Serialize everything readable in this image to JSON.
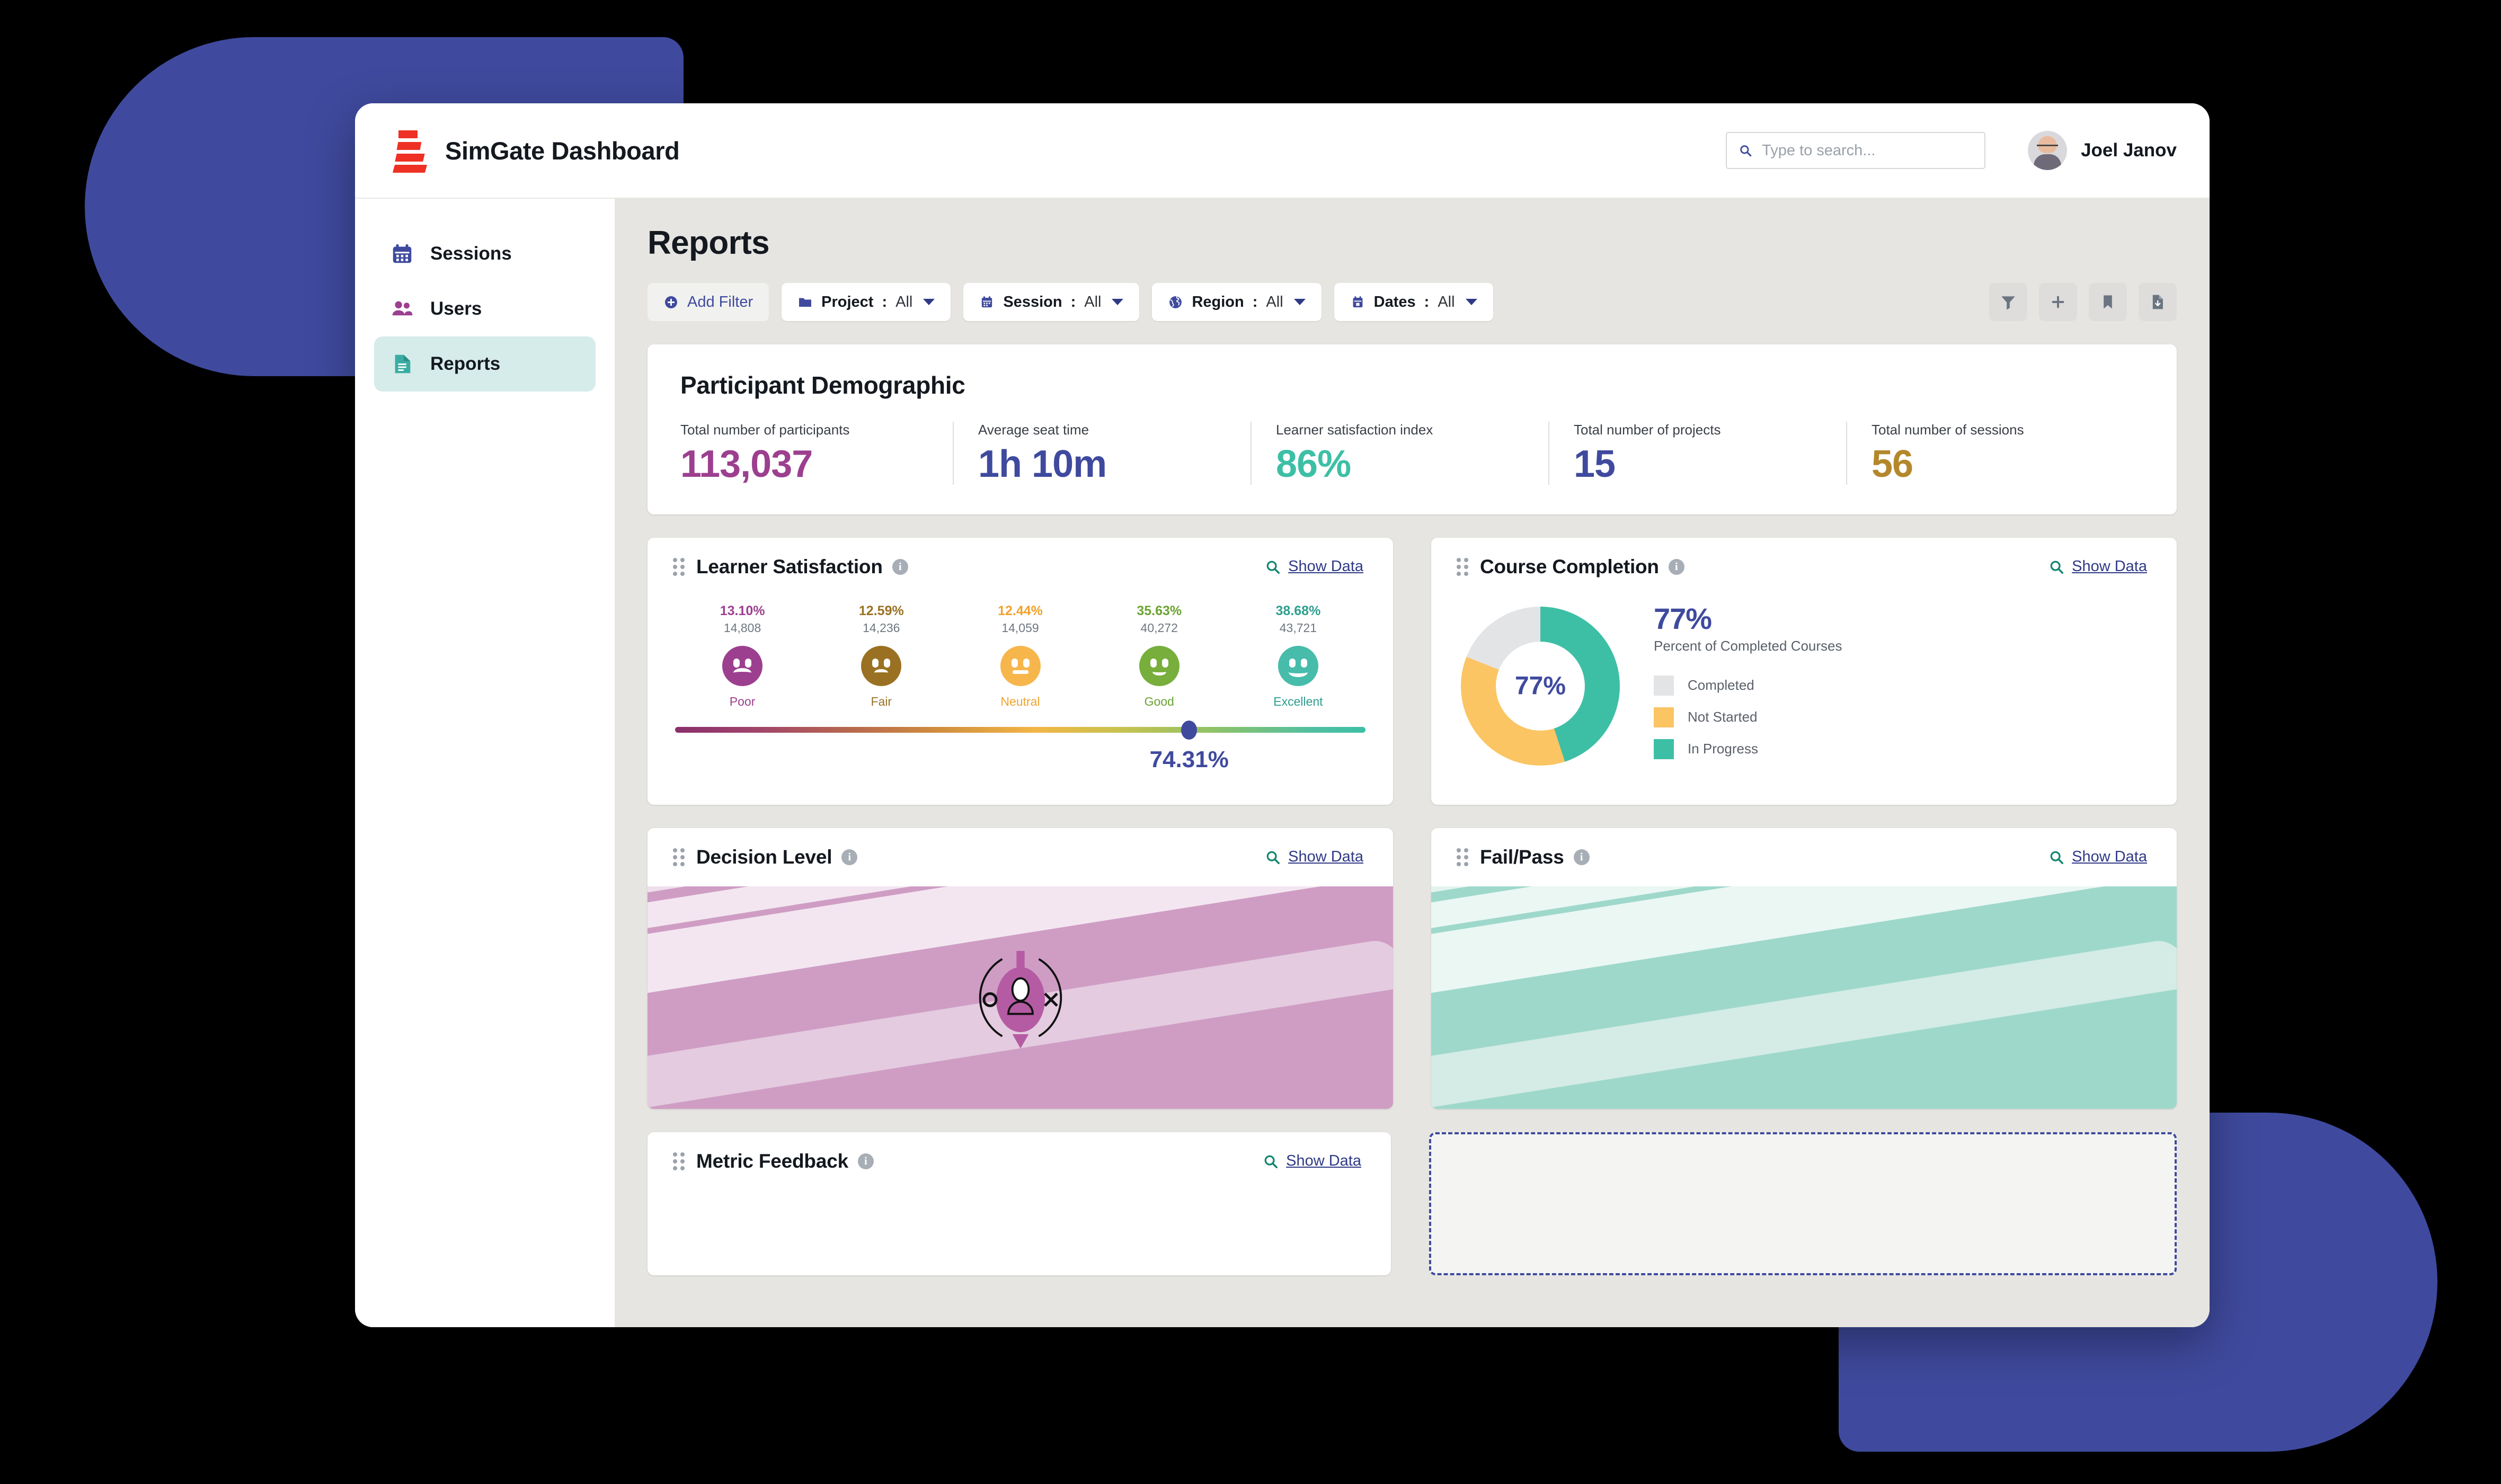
{
  "app": {
    "title": "SimGate Dashboard",
    "logo_icon": "simgate-bars-logo",
    "brand_color": "#ee3124"
  },
  "search": {
    "placeholder": "Type to search...",
    "value": "",
    "icon": "search-icon"
  },
  "user": {
    "name": "Joel Janov",
    "avatar_icon": "user-avatar"
  },
  "sidebar": {
    "items": [
      {
        "label": "Sessions",
        "icon": "calendar-icon",
        "color": "#3f4a9e",
        "active": false
      },
      {
        "label": "Users",
        "icon": "people-icon",
        "color": "#9c3f8f",
        "active": false
      },
      {
        "label": "Reports",
        "icon": "document-icon",
        "color": "#3aada3",
        "active": true
      }
    ]
  },
  "page": {
    "title": "Reports"
  },
  "filters": {
    "add_filter": {
      "label": "Add Filter",
      "icon": "plus-circle-icon"
    },
    "chips": [
      {
        "name": "Project",
        "value": "All",
        "icon": "folder-icon"
      },
      {
        "name": "Session",
        "value": "All",
        "icon": "calendar-icon"
      },
      {
        "name": "Region",
        "value": "All",
        "icon": "globe-icon"
      },
      {
        "name": "Dates",
        "value": "All",
        "icon": "calendar-date-icon"
      }
    ],
    "tools": [
      {
        "icon": "funnel-filter-icon",
        "name": "filter"
      },
      {
        "icon": "plus-icon",
        "name": "add"
      },
      {
        "icon": "bookmark-icon",
        "name": "bookmark"
      },
      {
        "icon": "file-download-icon",
        "name": "export"
      }
    ]
  },
  "demographic": {
    "title": "Participant Demographic",
    "stats": [
      {
        "label": "Total number of participants",
        "value": "113,037",
        "color": "#9c3f8f"
      },
      {
        "label": "Average seat time",
        "value": "1h 10m",
        "color": "#3f4a9e"
      },
      {
        "label": "Learner satisfaction index",
        "value": "86%",
        "color": "#3dbfa5"
      },
      {
        "label": "Total number of projects",
        "value": "15",
        "color": "#3f4a9e"
      },
      {
        "label": "Total number of sessions",
        "value": "56",
        "color": "#b3882c"
      }
    ]
  },
  "widgets": {
    "show_data_label": "Show Data",
    "learner_satisfaction": {
      "title": "Learner Satisfaction"
    },
    "course_completion": {
      "title": "Course Completion"
    },
    "decision_level": {
      "title": "Decision Level"
    },
    "fail_pass": {
      "title": "Fail/Pass"
    },
    "metric_feedback": {
      "title": "Metric Feedback"
    }
  },
  "chart_data": [
    {
      "type": "bar",
      "id": "learner-satisfaction",
      "title": "Learner Satisfaction",
      "categories": [
        "Poor",
        "Fair",
        "Neutral",
        "Good",
        "Excellent"
      ],
      "percent_labels": [
        "13.10%",
        "12.59%",
        "12.44%",
        "35.63%",
        "38.68%"
      ],
      "values": [
        13.1,
        12.59,
        12.44,
        35.63,
        38.68
      ],
      "count_labels": [
        "14,808",
        "14,236",
        "14,059",
        "40,272",
        "43,721"
      ],
      "counts": [
        14808,
        14236,
        14059,
        40272,
        43721
      ],
      "colors": [
        "#9c3f8f",
        "#9a7122",
        "#f7b64c",
        "#77ae3c",
        "#47bcab"
      ],
      "face_icons": [
        "sad-face-icon",
        "frown-face-icon",
        "neutral-face-icon",
        "smile-face-icon",
        "grin-face-icon"
      ],
      "gauge": {
        "value": 74.31,
        "label": "74.31%",
        "min": 0,
        "max": 100,
        "thumb_color": "#3f4a9e"
      },
      "xlabel": "",
      "ylabel": "",
      "grid": false,
      "legend": "none"
    },
    {
      "type": "pie",
      "id": "course-completion",
      "title": "Course Completion",
      "center_label": "77%",
      "headline": "77%",
      "subtitle": "Percent of Completed Courses",
      "labels": [
        "Completed",
        "Not Started",
        "In Progress"
      ],
      "values": [
        19,
        36,
        45
      ],
      "colors": [
        "#e3e4e6",
        "#fbc564",
        "#3dbfa5"
      ],
      "legend": "right"
    }
  ]
}
